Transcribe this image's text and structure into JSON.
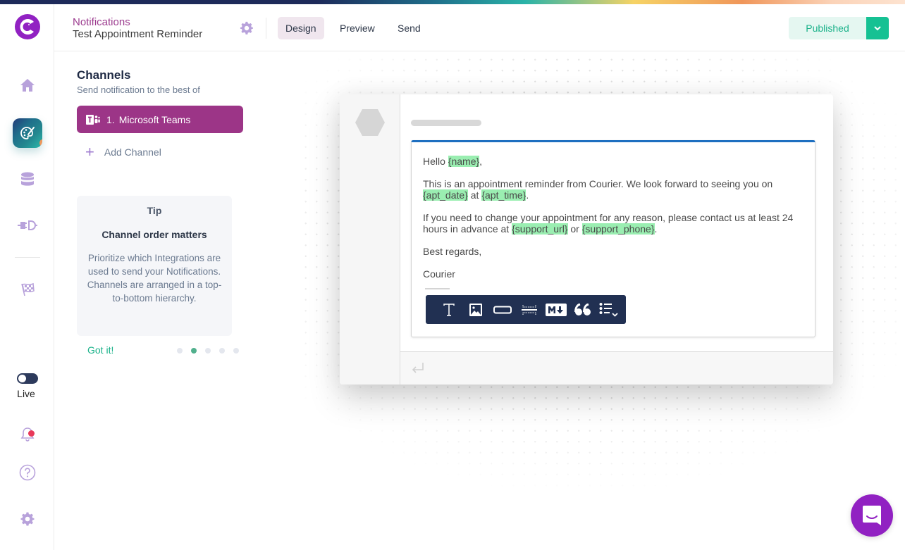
{
  "header": {
    "breadcrumb": "Notifications",
    "title": "Test Appointment Reminder",
    "tabs": [
      {
        "label": "Design",
        "active": true
      },
      {
        "label": "Preview",
        "active": false
      },
      {
        "label": "Send",
        "active": false
      }
    ],
    "publish_label": "Published"
  },
  "rail": {
    "items": [
      "home-icon",
      "designer-icon",
      "data-icon",
      "integrations-icon",
      "getting-started-icon"
    ],
    "live_label": "Live",
    "live_enabled": false
  },
  "channels": {
    "title": "Channels",
    "subtitle": "Send notification to the best of",
    "items": [
      {
        "index": "1.",
        "name": "Microsoft Teams"
      }
    ],
    "add_label": "Add Channel"
  },
  "tip": {
    "label": "Tip",
    "heading": "Channel order matters",
    "body": "Prioritize which Integrations are used to send your Notifications. Channels are arranged in a top-to-bottom hierarchy.",
    "dismiss_label": "Got it!",
    "pages": 5,
    "current_page": 2
  },
  "message": {
    "greeting_prefix": "Hello ",
    "var_name": "{name}",
    "greeting_suffix": ",",
    "line2_text": "This is an appointment reminder from Courier. We look forward to seeing you on",
    "var_apt_date": "{apt_date}",
    "line2_mid": " at ",
    "var_apt_time": "{apt_time}",
    "line2_end": ".",
    "line3_text": "If you need to change your appointment for any reason, please contact us at least 24 hours in advance at ",
    "var_support_url": "{support_url}",
    "line3_mid": " or ",
    "var_support_phone": "{support_phone}",
    "line3_end": ".",
    "closing": "Best regards,",
    "signature": "Courier"
  },
  "toolbar": {
    "items": [
      "text-block",
      "image-block",
      "action-button-block",
      "divider-block",
      "markdown-block",
      "quote-block",
      "list-block"
    ]
  },
  "colors": {
    "brand": "#9121c2",
    "channel_active": "#9c3587",
    "publish_green": "#16c193",
    "variable_highlight": "#9aeeb1",
    "toolbar_bg": "#213052"
  }
}
